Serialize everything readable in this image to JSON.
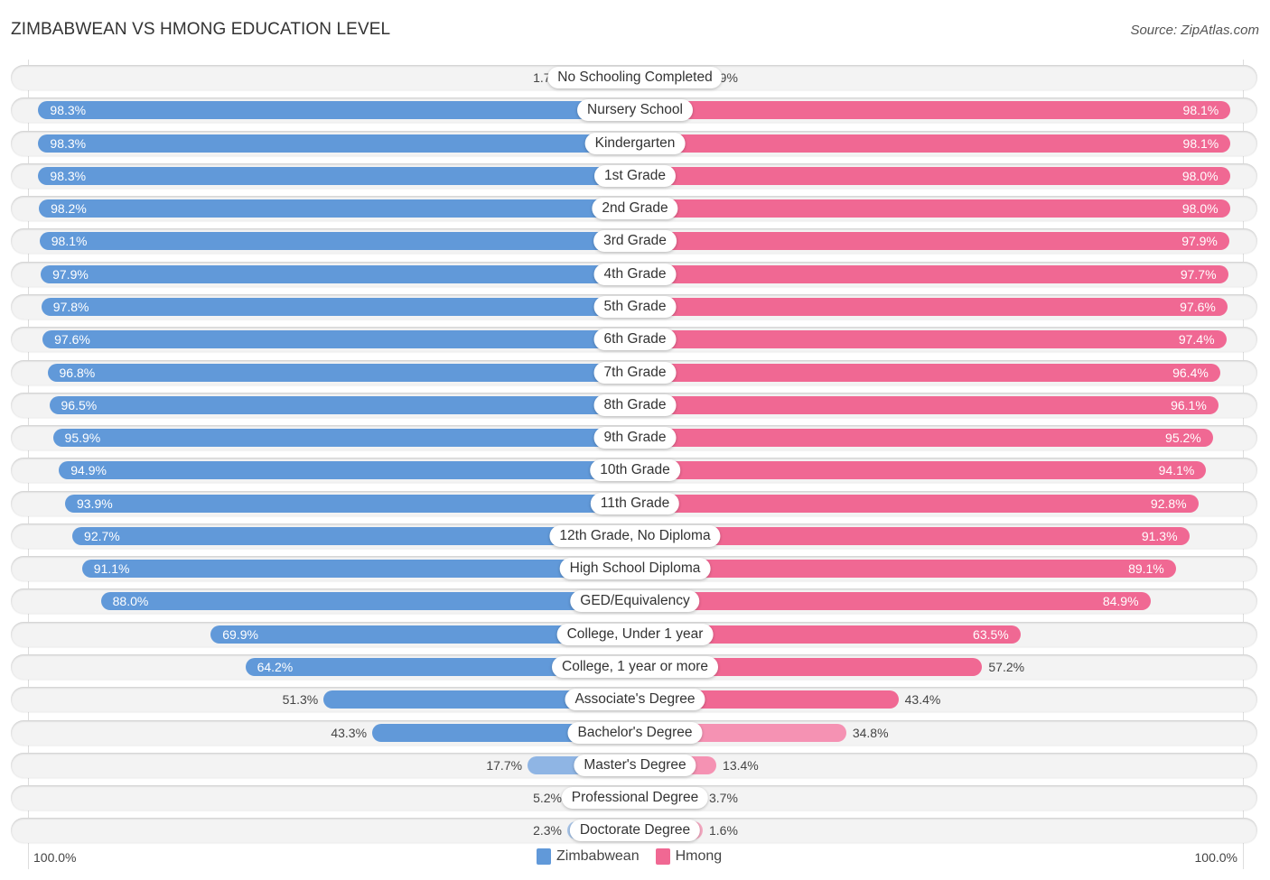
{
  "header": {
    "title": "ZIMBABWEAN VS HMONG EDUCATION LEVEL",
    "source": "Source: ZipAtlas.com"
  },
  "colors": {
    "left_strong": "#6199d9",
    "left_light": "#a7c5ea",
    "right_strong": "#f06893",
    "right_light": "#f6a9c2"
  },
  "chart_data": {
    "type": "bar",
    "orientation": "horizontal-diverging",
    "title": "ZIMBABWEAN VS HMONG EDUCATION LEVEL",
    "xlabel": "",
    "ylabel": "",
    "xlim": [
      0,
      100
    ],
    "axis_labels": {
      "left": "100.0%",
      "right": "100.0%"
    },
    "legend": {
      "placement": "bottom-center",
      "entries": [
        "Zimbabwean",
        "Hmong"
      ]
    },
    "categories": [
      "No Schooling Completed",
      "Nursery School",
      "Kindergarten",
      "1st Grade",
      "2nd Grade",
      "3rd Grade",
      "4th Grade",
      "5th Grade",
      "6th Grade",
      "7th Grade",
      "8th Grade",
      "9th Grade",
      "10th Grade",
      "11th Grade",
      "12th Grade, No Diploma",
      "High School Diploma",
      "GED/Equivalency",
      "College, Under 1 year",
      "College, 1 year or more",
      "Associate's Degree",
      "Bachelor's Degree",
      "Master's Degree",
      "Professional Degree",
      "Doctorate Degree"
    ],
    "series": [
      {
        "name": "Zimbabwean",
        "side": "left",
        "values": [
          1.7,
          98.3,
          98.3,
          98.3,
          98.2,
          98.1,
          97.9,
          97.8,
          97.6,
          96.8,
          96.5,
          95.9,
          94.9,
          93.9,
          92.7,
          91.1,
          88.0,
          69.9,
          64.2,
          51.3,
          43.3,
          17.7,
          5.2,
          2.3
        ],
        "labels": [
          "1.7%",
          "98.3%",
          "98.3%",
          "98.3%",
          "98.2%",
          "98.1%",
          "97.9%",
          "97.8%",
          "97.6%",
          "96.8%",
          "96.5%",
          "95.9%",
          "94.9%",
          "93.9%",
          "92.7%",
          "91.1%",
          "88.0%",
          "69.9%",
          "64.2%",
          "51.3%",
          "43.3%",
          "17.7%",
          "5.2%",
          "2.3%"
        ]
      },
      {
        "name": "Hmong",
        "side": "right",
        "values": [
          1.9,
          98.1,
          98.1,
          98.0,
          98.0,
          97.9,
          97.7,
          97.6,
          97.4,
          96.4,
          96.1,
          95.2,
          94.1,
          92.8,
          91.3,
          89.1,
          84.9,
          63.5,
          57.2,
          43.4,
          34.8,
          13.4,
          3.7,
          1.6
        ],
        "labels": [
          "1.9%",
          "98.1%",
          "98.1%",
          "98.0%",
          "98.0%",
          "97.9%",
          "97.7%",
          "97.6%",
          "97.4%",
          "96.4%",
          "96.1%",
          "95.2%",
          "94.1%",
          "92.8%",
          "91.3%",
          "89.1%",
          "84.9%",
          "63.5%",
          "57.2%",
          "43.4%",
          "34.8%",
          "13.4%",
          "3.7%",
          "1.6%"
        ]
      }
    ]
  }
}
